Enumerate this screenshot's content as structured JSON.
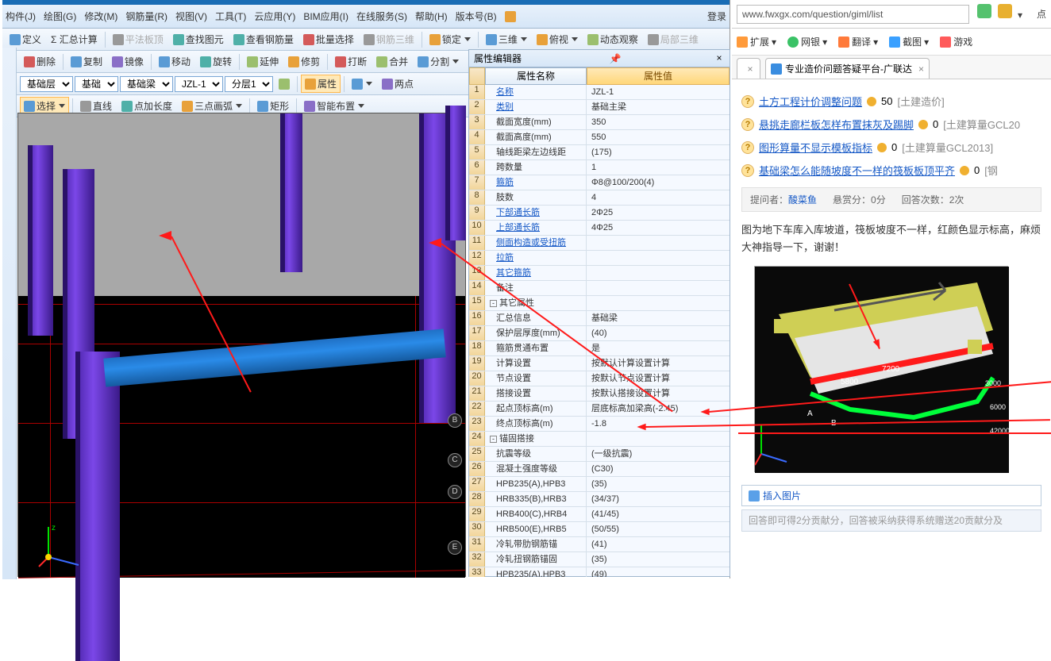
{
  "menu": {
    "items": [
      "构件(J)",
      "绘图(G)",
      "修改(M)",
      "钢筋量(R)",
      "视图(V)",
      "工具(T)",
      "云应用(Y)",
      "BIM应用(I)",
      "在线服务(S)",
      "帮助(H)",
      "版本号(B)"
    ],
    "login": "登录"
  },
  "toolbar1": {
    "define": "定义",
    "sum": "Σ 汇总计算",
    "flat": "平法板顶",
    "find": "查找图元",
    "rebar": "查看钢筋量",
    "batch": "批量选择",
    "rebar3d": "钢筋三维",
    "lock": "锁定",
    "threeD": "三维",
    "top": "俯视",
    "dyn": "动态观察",
    "local3d": "局部三维"
  },
  "toolbar2": {
    "del": "删除",
    "copy": "复制",
    "mirror": "镜像",
    "move": "移动",
    "rotate": "旋转",
    "extend": "延伸",
    "trim": "修剪",
    "break": "打断",
    "merge": "合并",
    "split": "分割"
  },
  "selects": {
    "layer": "基础层",
    "type": "基础",
    "beam": "基础梁",
    "name": "JZL-1",
    "sub": "分层1",
    "attr": "属性",
    "two": "两点"
  },
  "toolbar3": {
    "select": "选择",
    "line": "直线",
    "addlen": "点加长度",
    "arc": "三点画弧",
    "rect": "矩形",
    "smart": "智能布置"
  },
  "propPanel": {
    "title": "属性编辑器",
    "nameH": "属性名称",
    "valH": "属性值",
    "rows": [
      {
        "n": "1",
        "k": "名称",
        "v": "JZL-1",
        "link": true
      },
      {
        "n": "2",
        "k": "类别",
        "v": "基础主梁",
        "link": true
      },
      {
        "n": "3",
        "k": "截面宽度(mm)",
        "v": "350"
      },
      {
        "n": "4",
        "k": "截面高度(mm)",
        "v": "550"
      },
      {
        "n": "5",
        "k": "轴线距梁左边线距",
        "v": "(175)"
      },
      {
        "n": "6",
        "k": "跨数量",
        "v": "1"
      },
      {
        "n": "7",
        "k": "箍筋",
        "v": "Φ8@100/200(4)",
        "link": true
      },
      {
        "n": "8",
        "k": "肢数",
        "v": "4"
      },
      {
        "n": "9",
        "k": "下部通长筋",
        "v": "2Φ25",
        "link": true
      },
      {
        "n": "10",
        "k": "上部通长筋",
        "v": "4Φ25",
        "link": true
      },
      {
        "n": "11",
        "k": "侧面构造或受扭筋",
        "v": "",
        "link": true
      },
      {
        "n": "12",
        "k": "拉筋",
        "v": "",
        "link": true
      },
      {
        "n": "13",
        "k": "其它箍筋",
        "v": "",
        "link": true
      },
      {
        "n": "14",
        "k": "备注",
        "v": ""
      },
      {
        "n": "15",
        "k": "其它属性",
        "v": "",
        "group": true
      },
      {
        "n": "16",
        "k": "汇总信息",
        "v": "基础梁"
      },
      {
        "n": "17",
        "k": "保护层厚度(mm)",
        "v": "(40)"
      },
      {
        "n": "18",
        "k": "箍筋贯通布置",
        "v": "是"
      },
      {
        "n": "19",
        "k": "计算设置",
        "v": "按默认计算设置计算"
      },
      {
        "n": "20",
        "k": "节点设置",
        "v": "按默认节点设置计算"
      },
      {
        "n": "21",
        "k": "搭接设置",
        "v": "按默认搭接设置计算"
      },
      {
        "n": "22",
        "k": "起点顶标高(m)",
        "v": "层底标高加梁高(-2.45)"
      },
      {
        "n": "23",
        "k": "终点顶标高(m)",
        "v": "-1.8"
      },
      {
        "n": "24",
        "k": "锚固搭接",
        "v": "",
        "group": true
      },
      {
        "n": "25",
        "k": "抗震等级",
        "v": "(一级抗震)"
      },
      {
        "n": "26",
        "k": "混凝土强度等级",
        "v": "(C30)"
      },
      {
        "n": "27",
        "k": "HPB235(A),HPB3",
        "v": "(35)"
      },
      {
        "n": "28",
        "k": "HRB335(B),HRB3",
        "v": "(34/37)"
      },
      {
        "n": "29",
        "k": "HRB400(C),HRB4",
        "v": "(41/45)"
      },
      {
        "n": "30",
        "k": "HRB500(E),HRB5",
        "v": "(50/55)"
      },
      {
        "n": "31",
        "k": "冷轧带肋钢筋锚",
        "v": "(41)"
      },
      {
        "n": "32",
        "k": "冷轧扭钢筋锚固",
        "v": "(35)"
      },
      {
        "n": "33",
        "k": "HPB235(A),HPB3",
        "v": "(49)"
      }
    ],
    "bubbles": [
      "B",
      "C",
      "D",
      "E"
    ]
  },
  "browser": {
    "url": "www.fwxgx.com/question/giml/list",
    "extensions": [
      "扩展",
      "网银",
      "翻译",
      "截图",
      "游戏"
    ],
    "tabTitle": "专业造价问题答疑平台-广联达",
    "questions": [
      {
        "t": "土方工程计价调整问题",
        "pts": "50",
        "tag": "[土建造价]"
      },
      {
        "t": "悬挑走廊栏板怎样布置抹灰及踢脚",
        "pts": "0",
        "tag": "[土建算量GCL20"
      },
      {
        "t": "图形算量不显示模板指标",
        "pts": "0",
        "tag": "[土建算量GCL2013]"
      },
      {
        "t": "基础梁怎么能随坡度不一样的筏板板顶平齐",
        "pts": "0",
        "tag": "[钢"
      }
    ],
    "meta": {
      "asker": "提问者：",
      "name": "酸菜鱼",
      "bounty": "悬赏分：0分",
      "answers": "回答次数：2次"
    },
    "desc": "图为地下车库入库坡道，筏板坡度不一样，红颜色显示标高，麻烦大神指导一下，谢谢！",
    "upload": "插入图片",
    "answerHint": "回答即可得2分贡献分，回答被采纳获得系统赠送20贡献分及"
  },
  "diagramLabels": {
    "a": "A",
    "b": "B",
    "d7200": "7200",
    "d5800": "5800",
    "d3000": "3000",
    "d6000": "6000",
    "d42000": "42000"
  }
}
